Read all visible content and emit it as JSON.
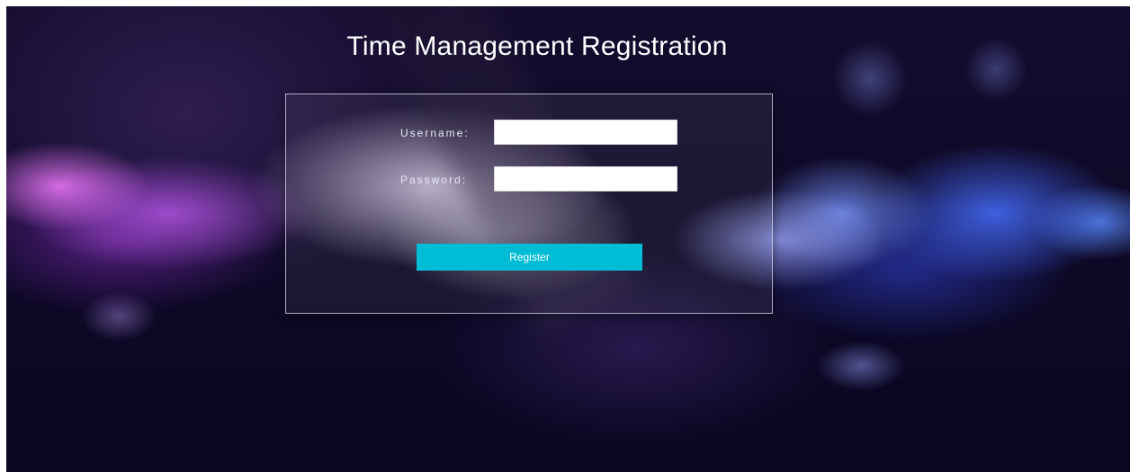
{
  "page": {
    "title": "Time Management Registration"
  },
  "form": {
    "username_label": "Username:",
    "username_value": "",
    "password_label": "Password:",
    "password_value": "",
    "register_label": "Register"
  },
  "colors": {
    "button_bg": "#00bcd4",
    "text": "#ffffff",
    "background_dark": "#0a0520"
  }
}
